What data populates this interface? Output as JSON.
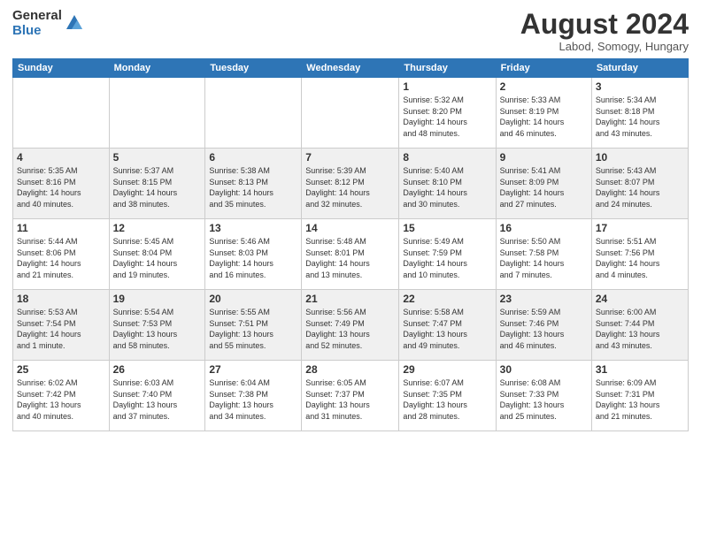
{
  "header": {
    "logo_general": "General",
    "logo_blue": "Blue",
    "month_title": "August 2024",
    "location": "Labod, Somogy, Hungary"
  },
  "days_of_week": [
    "Sunday",
    "Monday",
    "Tuesday",
    "Wednesday",
    "Thursday",
    "Friday",
    "Saturday"
  ],
  "weeks": [
    [
      {
        "day": "",
        "info": ""
      },
      {
        "day": "",
        "info": ""
      },
      {
        "day": "",
        "info": ""
      },
      {
        "day": "",
        "info": ""
      },
      {
        "day": "1",
        "info": "Sunrise: 5:32 AM\nSunset: 8:20 PM\nDaylight: 14 hours\nand 48 minutes."
      },
      {
        "day": "2",
        "info": "Sunrise: 5:33 AM\nSunset: 8:19 PM\nDaylight: 14 hours\nand 46 minutes."
      },
      {
        "day": "3",
        "info": "Sunrise: 5:34 AM\nSunset: 8:18 PM\nDaylight: 14 hours\nand 43 minutes."
      }
    ],
    [
      {
        "day": "4",
        "info": "Sunrise: 5:35 AM\nSunset: 8:16 PM\nDaylight: 14 hours\nand 40 minutes."
      },
      {
        "day": "5",
        "info": "Sunrise: 5:37 AM\nSunset: 8:15 PM\nDaylight: 14 hours\nand 38 minutes."
      },
      {
        "day": "6",
        "info": "Sunrise: 5:38 AM\nSunset: 8:13 PM\nDaylight: 14 hours\nand 35 minutes."
      },
      {
        "day": "7",
        "info": "Sunrise: 5:39 AM\nSunset: 8:12 PM\nDaylight: 14 hours\nand 32 minutes."
      },
      {
        "day": "8",
        "info": "Sunrise: 5:40 AM\nSunset: 8:10 PM\nDaylight: 14 hours\nand 30 minutes."
      },
      {
        "day": "9",
        "info": "Sunrise: 5:41 AM\nSunset: 8:09 PM\nDaylight: 14 hours\nand 27 minutes."
      },
      {
        "day": "10",
        "info": "Sunrise: 5:43 AM\nSunset: 8:07 PM\nDaylight: 14 hours\nand 24 minutes."
      }
    ],
    [
      {
        "day": "11",
        "info": "Sunrise: 5:44 AM\nSunset: 8:06 PM\nDaylight: 14 hours\nand 21 minutes."
      },
      {
        "day": "12",
        "info": "Sunrise: 5:45 AM\nSunset: 8:04 PM\nDaylight: 14 hours\nand 19 minutes."
      },
      {
        "day": "13",
        "info": "Sunrise: 5:46 AM\nSunset: 8:03 PM\nDaylight: 14 hours\nand 16 minutes."
      },
      {
        "day": "14",
        "info": "Sunrise: 5:48 AM\nSunset: 8:01 PM\nDaylight: 14 hours\nand 13 minutes."
      },
      {
        "day": "15",
        "info": "Sunrise: 5:49 AM\nSunset: 7:59 PM\nDaylight: 14 hours\nand 10 minutes."
      },
      {
        "day": "16",
        "info": "Sunrise: 5:50 AM\nSunset: 7:58 PM\nDaylight: 14 hours\nand 7 minutes."
      },
      {
        "day": "17",
        "info": "Sunrise: 5:51 AM\nSunset: 7:56 PM\nDaylight: 14 hours\nand 4 minutes."
      }
    ],
    [
      {
        "day": "18",
        "info": "Sunrise: 5:53 AM\nSunset: 7:54 PM\nDaylight: 14 hours\nand 1 minute."
      },
      {
        "day": "19",
        "info": "Sunrise: 5:54 AM\nSunset: 7:53 PM\nDaylight: 13 hours\nand 58 minutes."
      },
      {
        "day": "20",
        "info": "Sunrise: 5:55 AM\nSunset: 7:51 PM\nDaylight: 13 hours\nand 55 minutes."
      },
      {
        "day": "21",
        "info": "Sunrise: 5:56 AM\nSunset: 7:49 PM\nDaylight: 13 hours\nand 52 minutes."
      },
      {
        "day": "22",
        "info": "Sunrise: 5:58 AM\nSunset: 7:47 PM\nDaylight: 13 hours\nand 49 minutes."
      },
      {
        "day": "23",
        "info": "Sunrise: 5:59 AM\nSunset: 7:46 PM\nDaylight: 13 hours\nand 46 minutes."
      },
      {
        "day": "24",
        "info": "Sunrise: 6:00 AM\nSunset: 7:44 PM\nDaylight: 13 hours\nand 43 minutes."
      }
    ],
    [
      {
        "day": "25",
        "info": "Sunrise: 6:02 AM\nSunset: 7:42 PM\nDaylight: 13 hours\nand 40 minutes."
      },
      {
        "day": "26",
        "info": "Sunrise: 6:03 AM\nSunset: 7:40 PM\nDaylight: 13 hours\nand 37 minutes."
      },
      {
        "day": "27",
        "info": "Sunrise: 6:04 AM\nSunset: 7:38 PM\nDaylight: 13 hours\nand 34 minutes."
      },
      {
        "day": "28",
        "info": "Sunrise: 6:05 AM\nSunset: 7:37 PM\nDaylight: 13 hours\nand 31 minutes."
      },
      {
        "day": "29",
        "info": "Sunrise: 6:07 AM\nSunset: 7:35 PM\nDaylight: 13 hours\nand 28 minutes."
      },
      {
        "day": "30",
        "info": "Sunrise: 6:08 AM\nSunset: 7:33 PM\nDaylight: 13 hours\nand 25 minutes."
      },
      {
        "day": "31",
        "info": "Sunrise: 6:09 AM\nSunset: 7:31 PM\nDaylight: 13 hours\nand 21 minutes."
      }
    ]
  ]
}
